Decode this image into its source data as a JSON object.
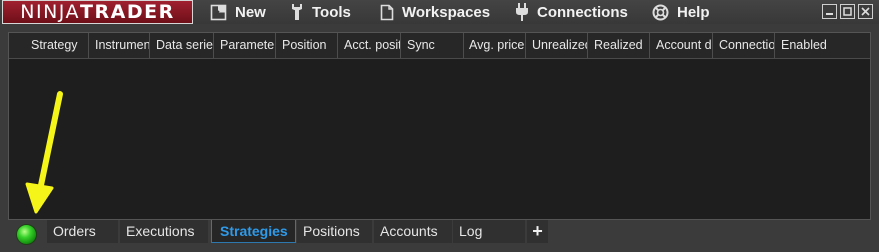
{
  "logo": {
    "part1": "NINJA",
    "part2": "TRADER"
  },
  "menu": [
    {
      "label": "New",
      "icon": "new-window-icon"
    },
    {
      "label": "Tools",
      "icon": "wrench-icon"
    },
    {
      "label": "Workspaces",
      "icon": "document-icon"
    },
    {
      "label": "Connections",
      "icon": "plug-icon"
    },
    {
      "label": "Help",
      "icon": "lifebuoy-icon"
    }
  ],
  "window_controls": [
    "minimize-icon",
    "maximize-icon",
    "close-icon"
  ],
  "grid": {
    "columns": [
      "Strategy",
      "Instrument",
      "Data series",
      "Parameters",
      "Position",
      "Acct. position",
      "Sync",
      "Avg. price",
      "Unrealized",
      "Realized",
      "Account display name",
      "Connection",
      "Enabled"
    ],
    "rows": []
  },
  "tabs": [
    "Orders",
    "Executions",
    "Strategies",
    "Positions",
    "Accounts",
    "Log"
  ],
  "active_tab": "Strategies",
  "add_tab_label": "+",
  "status": {
    "connection_indicator": "connected",
    "color": "#37d22a"
  },
  "colors": {
    "accent": "#2e9bea",
    "brand": "#8a1a26",
    "annotation_arrow": "#f5f51a"
  }
}
